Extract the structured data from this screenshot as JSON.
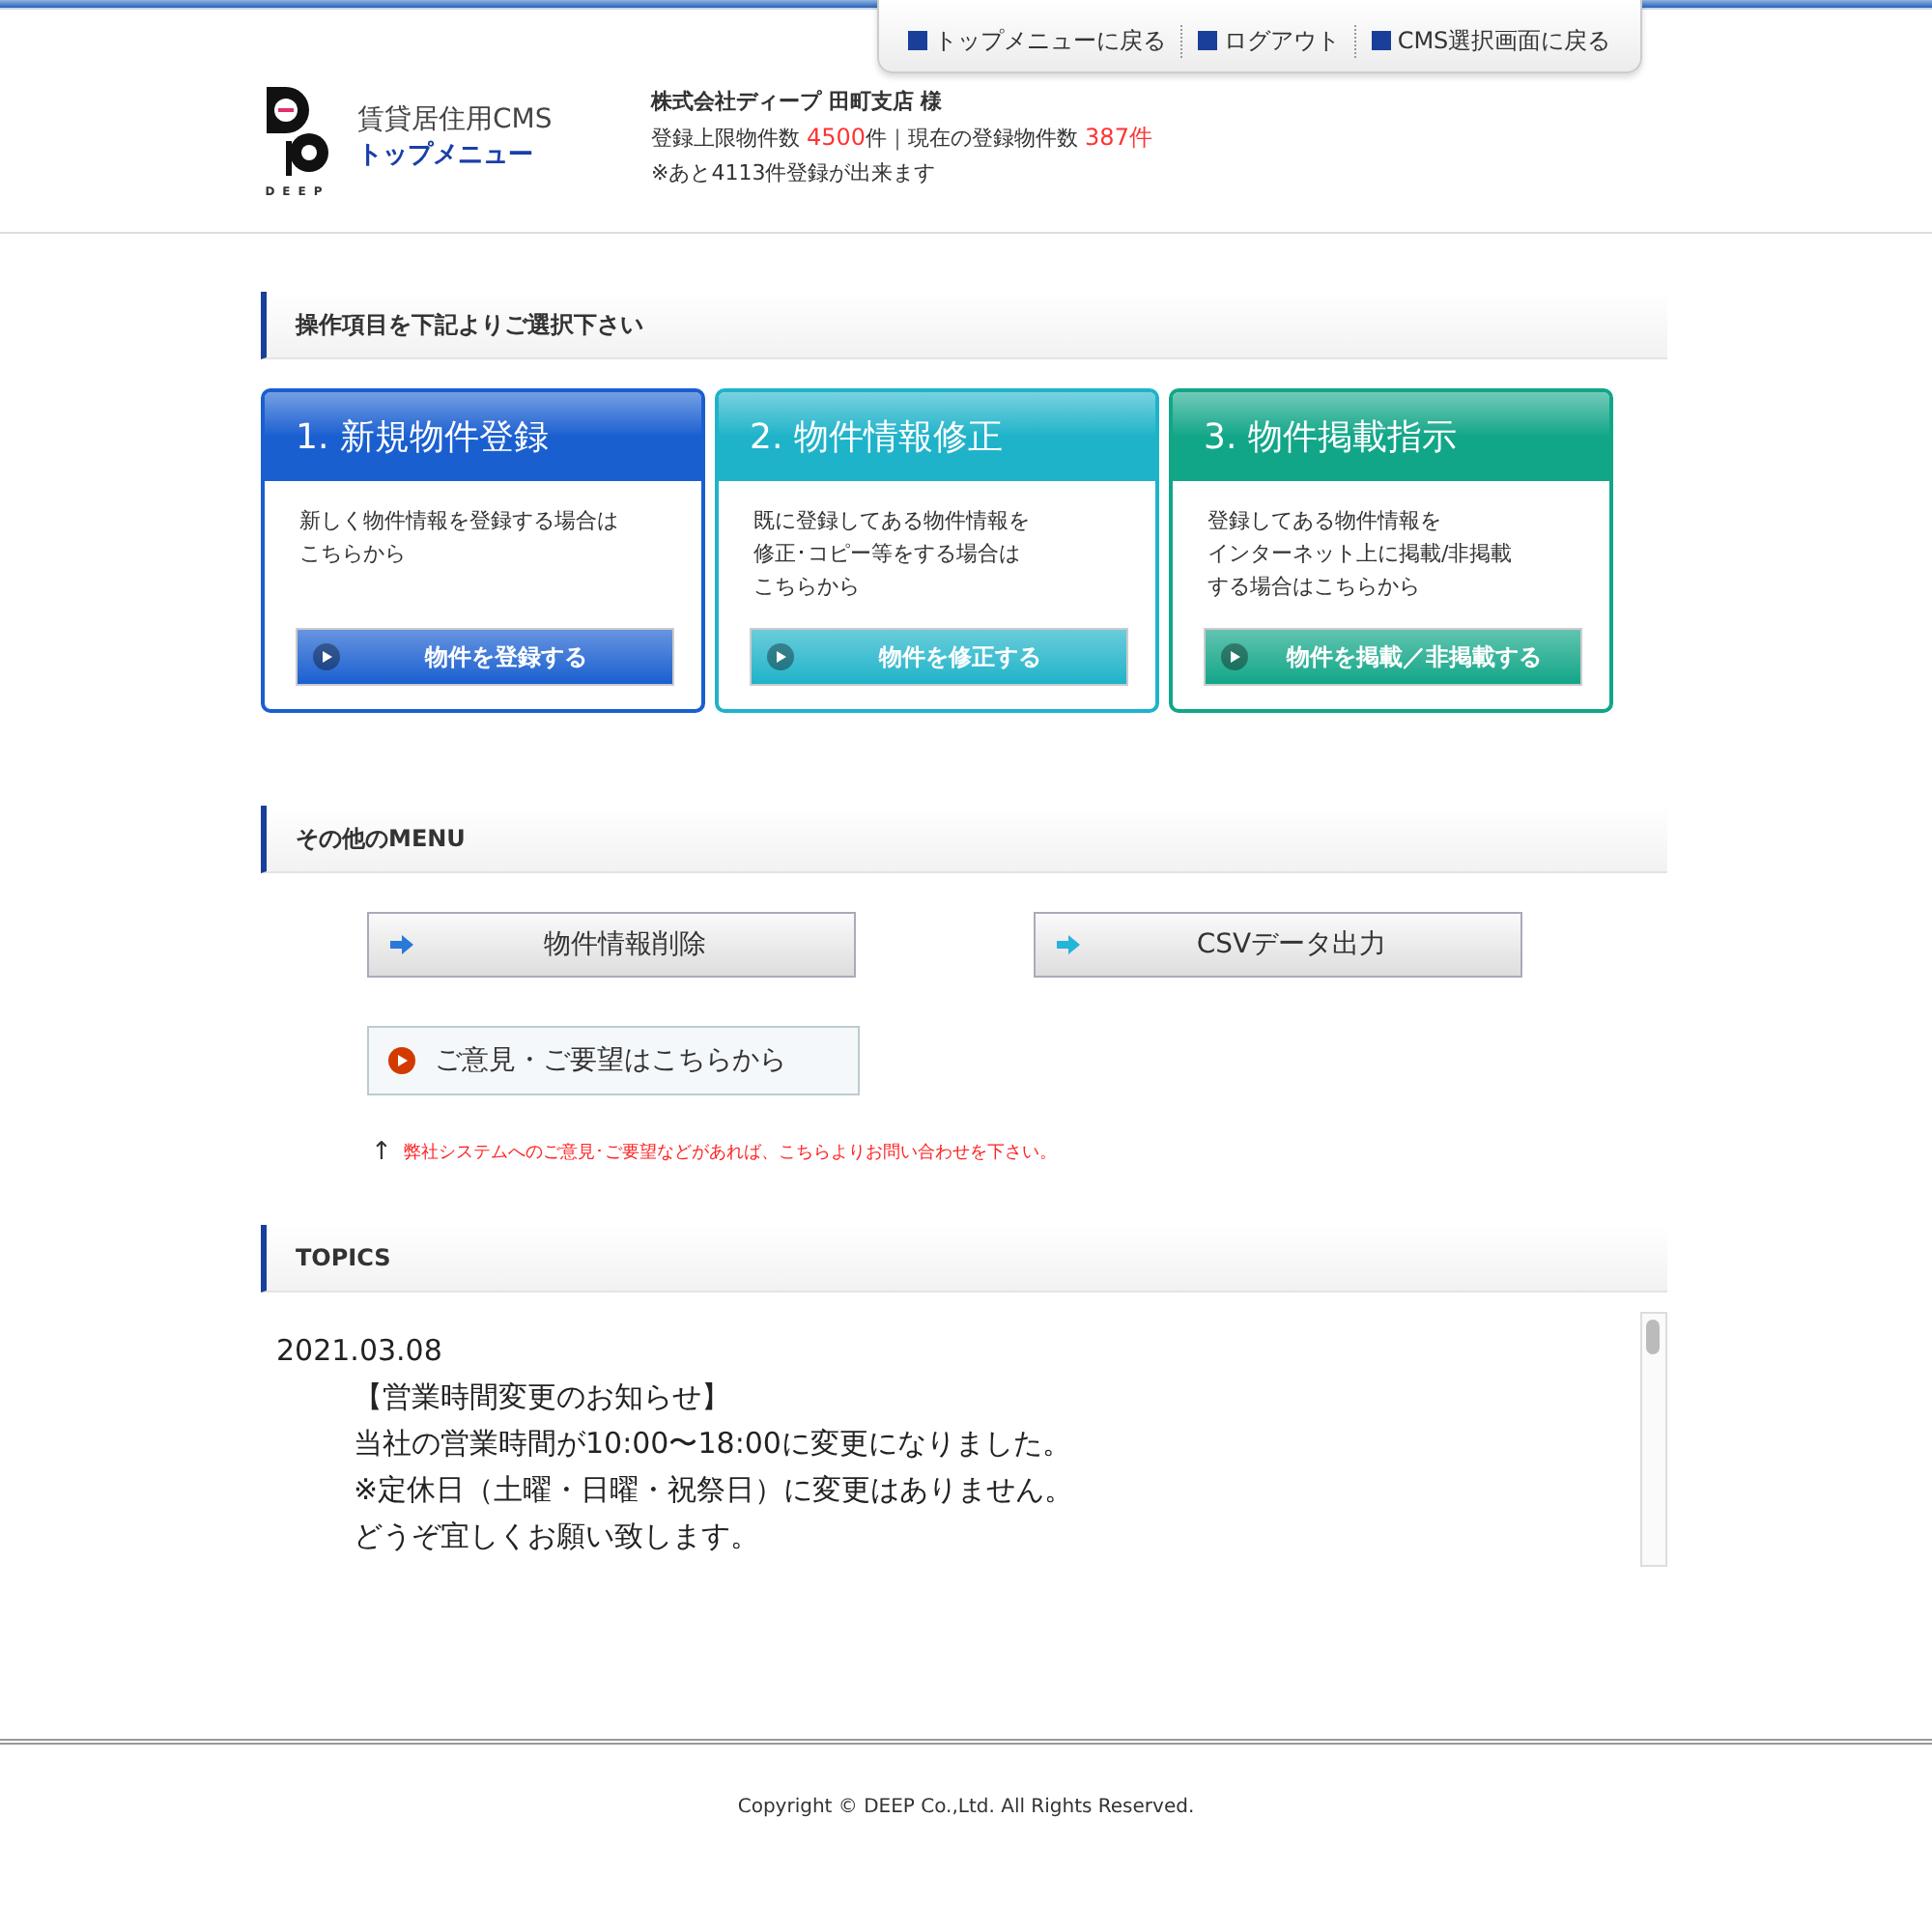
{
  "top_nav": [
    {
      "label": "トップメニューに戻る"
    },
    {
      "label": "ログアウト"
    },
    {
      "label": "CMS選択画面に戻る"
    }
  ],
  "header": {
    "logo_text": "DEEP",
    "app_name": "賃貸居住用CMS",
    "page_name": "トップメニュー",
    "company": "株式会社ディープ 田町支店 様",
    "limit_label": "登録上限物件数",
    "limit_value": "4500",
    "limit_unit": "件",
    "separator": "｜",
    "current_label": "現在の登録物件数",
    "current_value": "387",
    "current_unit": "件",
    "remaining": "※あと4113件登録が出来ます"
  },
  "section_operations": {
    "title": "操作項目を下記よりご選択下さい"
  },
  "cards": [
    {
      "title": "1. 新規物件登録",
      "color": "#1a5fd0",
      "description": [
        "新しく物件情報を登録する場合は",
        "こちらから"
      ],
      "button": "物件を登録する"
    },
    {
      "title": "2. 物件情報修正",
      "color": "#1fb3c9",
      "description": [
        "既に登録してある物件情報を",
        "修正･コピー等をする場合は",
        "こちらから"
      ],
      "button": "物件を修正する"
    },
    {
      "title": "3. 物件掲載指示",
      "color": "#12a688",
      "description": [
        "登録してある物件情報を",
        "インターネット上に掲載/非掲載",
        "する場合はこちらから"
      ],
      "button": "物件を掲載／非掲載する"
    }
  ],
  "section_other": {
    "title": "その他のMENU"
  },
  "other_menu": [
    {
      "label": "物件情報削除",
      "color": "#2a78d8"
    },
    {
      "label": "CSVデータ出力",
      "color": "#25b5d8"
    }
  ],
  "feedback": {
    "label": "ご意見・ご要望はこちらから",
    "arrow": "↑",
    "note": "弊社システムへのご意見･ご要望などがあれば、こちらよりお問い合わせを下さい。"
  },
  "section_topics": {
    "title": "TOPICS"
  },
  "topics": [
    {
      "date": "2021.03.08",
      "lines": [
        "【営業時間変更のお知らせ】",
        "当社の営業時間が10:00〜18:00に変更になりました。",
        "※定休日（土曜・日曜・祝祭日）に変更はありません。",
        "どうぞ宜しくお願い致します。"
      ]
    }
  ],
  "footer": {
    "copyright": "Copyright © DEEP Co.,Ltd. All Rights Reserved."
  }
}
